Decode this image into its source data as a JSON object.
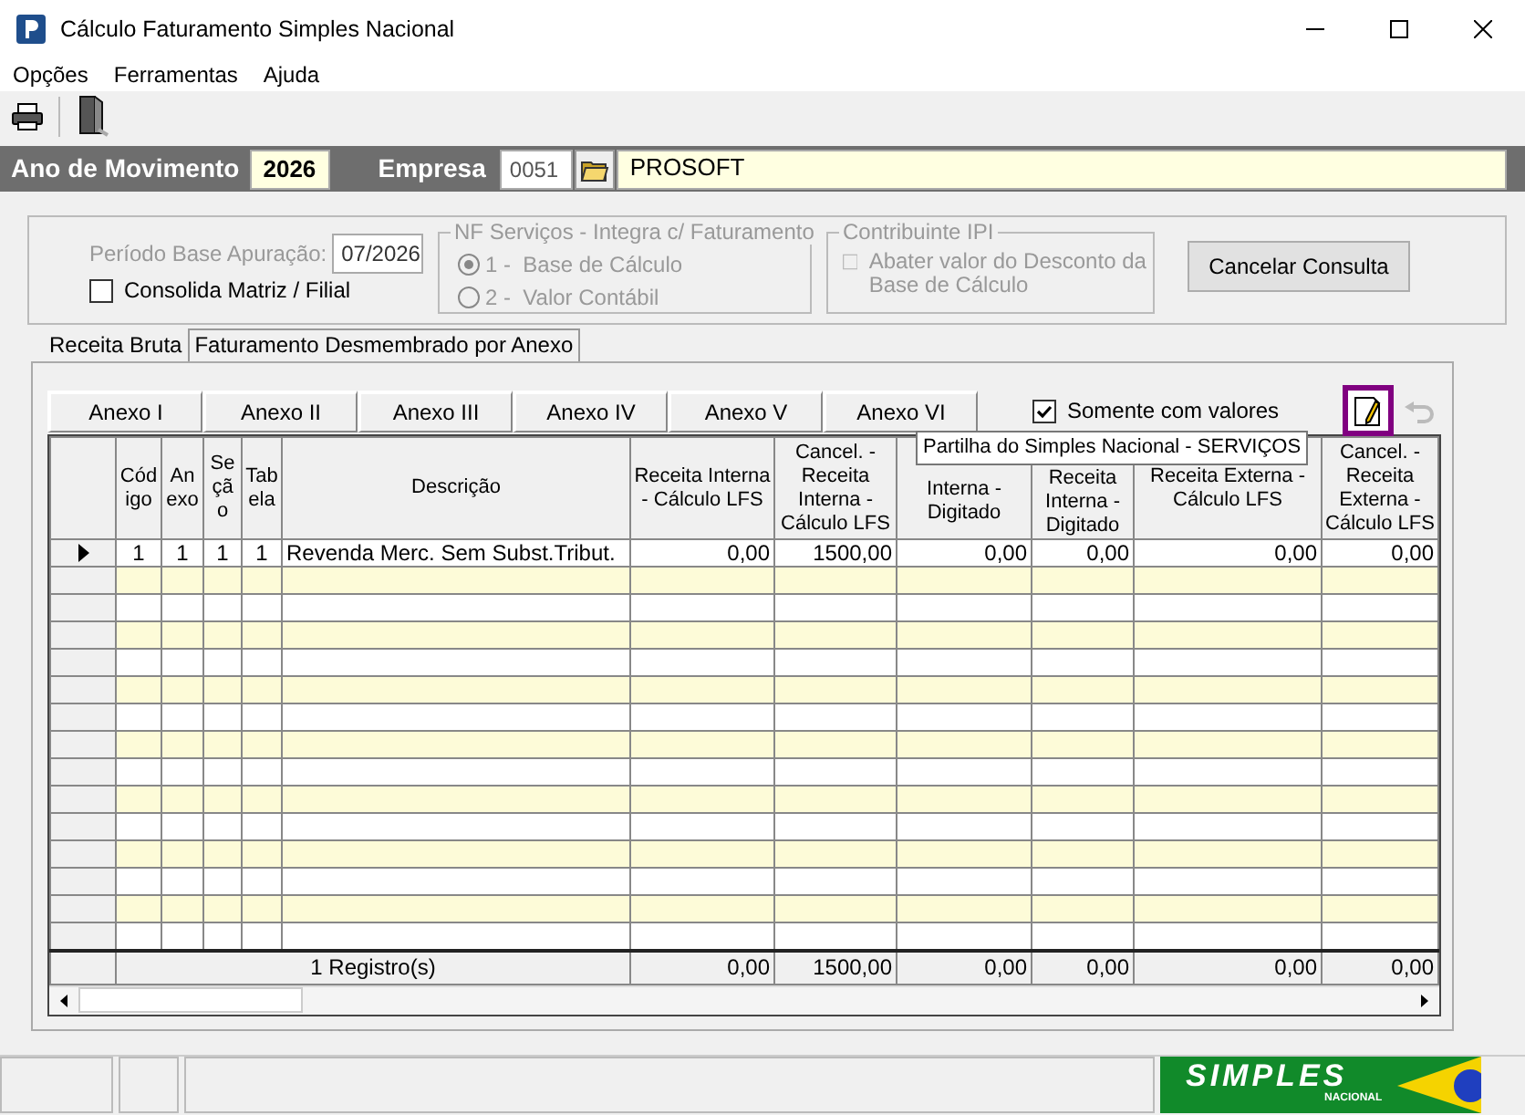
{
  "window": {
    "title": "Cálculo Faturamento Simples Nacional"
  },
  "menu": [
    {
      "label": "Opções"
    },
    {
      "label": "Ferramentas"
    },
    {
      "label": "Ajuda"
    }
  ],
  "header": {
    "year_label": "Ano de Movimento",
    "year": "2026",
    "company_label": "Empresa",
    "company_code": "0051",
    "company_name": "PROSOFT"
  },
  "filters": {
    "period_label": "Período Base Apuração:",
    "period": "07/2026",
    "consolidate": {
      "label": "Consolida Matriz / Filial",
      "checked": false
    },
    "nf_group": {
      "title": "NF Serviços - Integra c/ Faturamento",
      "disabled": true,
      "options": [
        {
          "label": "1 -  Base de Cálculo",
          "selected": true
        },
        {
          "label": "2 -  Valor Contábil",
          "selected": false
        }
      ]
    },
    "ipi_group": {
      "title": "Contribuinte IPI",
      "disabled": true,
      "option": {
        "label": "Abater valor do Desconto da Base de Cálculo",
        "checked": false
      }
    },
    "cancel_button": "Cancelar Consulta"
  },
  "tabs": [
    {
      "label": "Receita Bruta",
      "selected": false
    },
    {
      "label": "Faturamento Desmembrado por Anexo",
      "selected": true
    }
  ],
  "annex_buttons": [
    "Anexo I",
    "Anexo II",
    "Anexo III",
    "Anexo IV",
    "Anexo V",
    "Anexo VI"
  ],
  "only_values": {
    "label": "Somente com valores",
    "checked": true
  },
  "tooltip": "Partilha do Simples Nacional - SERVIÇOS",
  "table": {
    "columns": [
      "Cód igo",
      "An exo",
      "Se çã o",
      "Tab ela",
      "Descrição",
      "Receita Interna - Cálculo LFS",
      "Cancel. - Receita Interna - Cálculo LFS",
      "Interna - Digitado",
      "Receita Interna - Digitado",
      "Receita Externa - Cálculo LFS",
      "Cancel. - Receita Externa - Cálculo LFS"
    ],
    "rows": [
      {
        "current": true,
        "cells": [
          "1",
          "1",
          "1",
          "1",
          "Revenda Merc. Sem Subst.Tribut.",
          "0,00",
          "1500,00",
          "0,00",
          "0,00",
          "0,00",
          "0,00"
        ]
      }
    ],
    "footer": {
      "count": "1 Registro(s)",
      "totals": [
        "0,00",
        "1500,00",
        "0,00",
        "0,00",
        "0,00",
        "0,00"
      ]
    }
  },
  "logo": {
    "text": "SIMPLES",
    "subtext": "NACIONAL"
  }
}
